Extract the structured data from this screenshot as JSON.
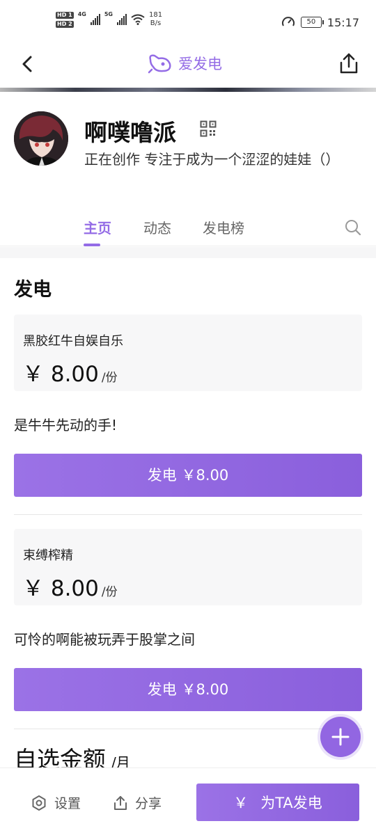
{
  "status_bar": {
    "network_speed": "181",
    "network_speed_unit": "B/s",
    "sim1_label": "HD 1",
    "sim2_label": "HD 2",
    "net1": "4G",
    "net2": "5G",
    "battery": "50",
    "time": "15:17"
  },
  "nav": {
    "brand_name": "爱发电",
    "icons": {
      "back": "chevron-left-icon",
      "share": "share-icon",
      "logo": "brand-logo-icon"
    }
  },
  "profile": {
    "name": "啊噗噜派",
    "bio": "正在创作 专注于成为一个涩涩的娃娃（）"
  },
  "tabs": [
    {
      "label": "主页",
      "active": true
    },
    {
      "label": "动态",
      "active": false
    },
    {
      "label": "发电榜",
      "active": false
    }
  ],
  "section_title": "发电",
  "tiers": [
    {
      "name": "黑胶红牛自娱自乐",
      "price": "￥ 8.00",
      "unit": "/份",
      "description": "是牛牛先动的手!",
      "button_label": "发电 ￥8.00"
    },
    {
      "name": "束缚榨精",
      "price": "￥ 8.00",
      "unit": "/份",
      "description": "可怜的啊能被玩弄于股掌之间",
      "button_label": "发电 ￥8.00"
    }
  ],
  "custom_amount": {
    "title": "自选金额",
    "unit": "/月"
  },
  "bottom_bar": {
    "settings_label": "设置",
    "share_label": "分享",
    "cta_symbol": "￥",
    "cta_label": "为TA发电"
  },
  "colors": {
    "accent": "#946ce6",
    "button": "#8a5fdc",
    "card_bg": "#f7f7f8"
  }
}
